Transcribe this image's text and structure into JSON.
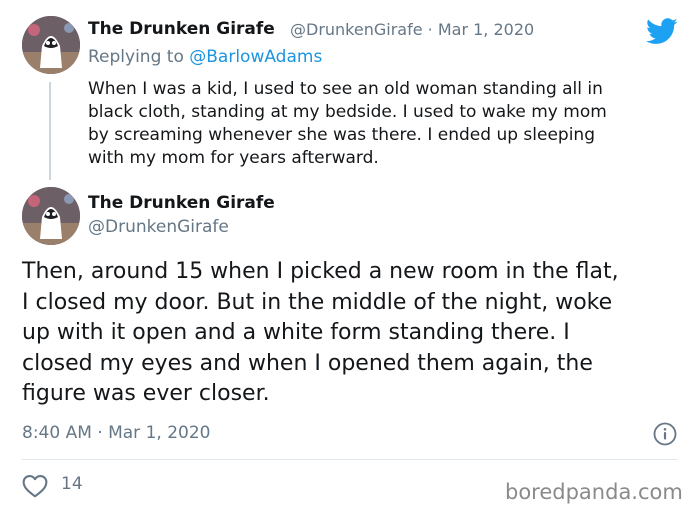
{
  "reply_tweet": {
    "display_name": "The Drunken Girafe",
    "handle": "@DrunkenGirafe",
    "separator": "·",
    "date": "Mar 1, 2020",
    "replying_to_prefix": "Replying to",
    "replying_to_handle": "@BarlowAdams",
    "lines": [
      "When I was a kid, I used to see an old woman standing all in",
      "black cloth, standing at my bedside. I used to wake my mom",
      "by screaming whenever she was there. I ended up sleeping",
      "with my mom for years afterward."
    ]
  },
  "main_tweet": {
    "display_name": "The Drunken Girafe",
    "handle": "@DrunkenGirafe",
    "lines": [
      "Then, around 15 when I picked a new room in the flat,",
      "I closed my door. But in the middle of the night, woke",
      "up with it open and a white form standing there. I",
      "closed my eyes and when I opened them again, the",
      "figure was ever closer."
    ],
    "timestamp": "8:40 AM · Mar 1, 2020",
    "like_count": "14"
  },
  "watermark": "boredpanda.com",
  "icons": {
    "brand": "twitter-bird-icon",
    "info": "info-icon",
    "like": "heart-icon"
  },
  "colors": {
    "twitter_blue": "#1da1f2",
    "text": "#14171a",
    "muted": "#657786",
    "link": "#1b95e0"
  }
}
